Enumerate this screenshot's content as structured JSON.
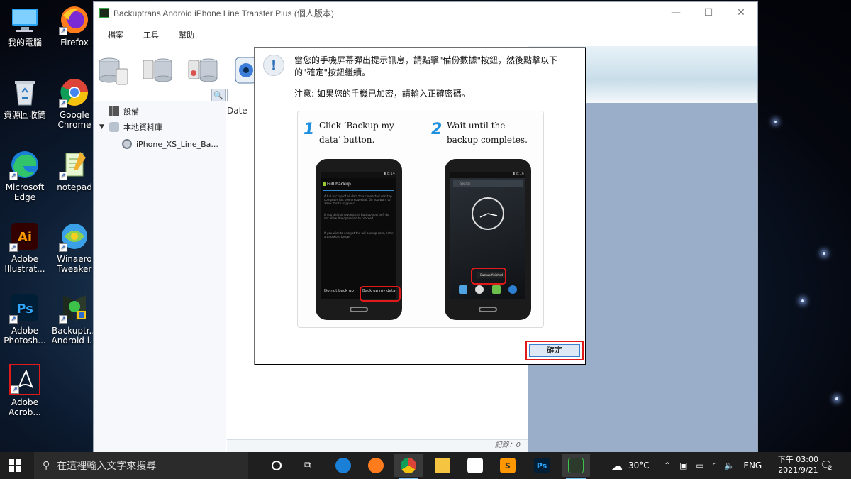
{
  "desktop": {
    "icons": [
      {
        "label": "我的電腦"
      },
      {
        "label": "Firefox"
      },
      {
        "label": "資源回收筒"
      },
      {
        "label": "Google Chrome"
      },
      {
        "label": "Microsoft Edge"
      },
      {
        "label": "notepad"
      },
      {
        "label": "Adobe Illustrat..."
      },
      {
        "label": "Winaero Tweaker"
      },
      {
        "label": "Adobe Photosh..."
      },
      {
        "label": "Backuptr... Android i..."
      },
      {
        "label": "Adobe Acrob..."
      }
    ]
  },
  "app": {
    "title": "Backuptrans Android iPhone Line Transfer Plus (個人版本)",
    "menu": [
      "檔案",
      "工具",
      "幫助"
    ],
    "tree": {
      "devices": "設備",
      "local_db": "本地資料庫",
      "backup_item": "iPhone_XS_Line_Ba..."
    },
    "column_header": "Date",
    "status": "記錄：0"
  },
  "dialog": {
    "message": "當您的手機屏幕彈出提示訊息，請點擊\"備份數據\"按鈕，然後點擊以下的\"確定\"按鈕繼續。",
    "note": "注意: 如果您的手機已加密，請輸入正確密碼。",
    "step1": {
      "num": "1",
      "text": "Click ‘Backup my data’ button."
    },
    "step2": {
      "num": "2",
      "text": "Wait until the backup completes."
    },
    "phone1": {
      "title": "Full backup",
      "text1": "A full backup of all data to a connected desktop computer has been requested. Do you want to allow this to happen?",
      "text2": "If you did not request the backup yourself, do not allow the operation to proceed.",
      "text3": "If you wish to encrypt the full backup data, enter a password below.",
      "btn_no": "Do not back up",
      "btn_yes": "Back up my data"
    },
    "phone2": {
      "toast": "Backup finished",
      "search": "Search"
    },
    "ok": "確定"
  },
  "taskbar": {
    "search_placeholder": "在這裡輸入文字來搜尋",
    "weather": "30°C",
    "lang": "ENG",
    "time": "下午 03:00",
    "date": "2021/9/21",
    "notif_count": "2"
  },
  "colors": {
    "accent_red": "#e01919",
    "step_blue": "#1f8fe0",
    "taskbar": "#1f1f1f",
    "side_panel": "#9aaec9"
  }
}
